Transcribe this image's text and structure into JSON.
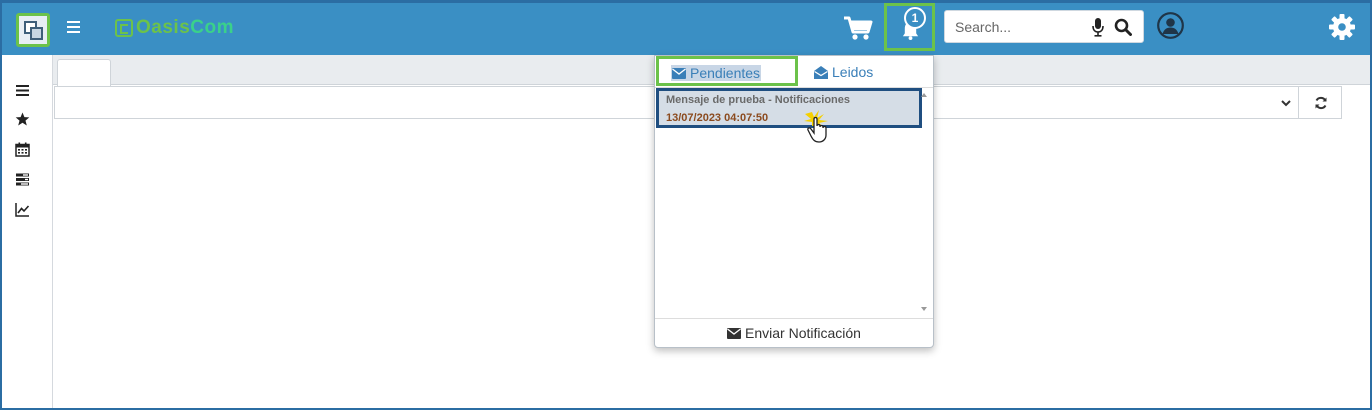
{
  "header": {
    "logo_text_1": "Oasis",
    "logo_text_2": "Com",
    "notification_count": "1",
    "search_placeholder": "Search...",
    "accent_color": "#3a8fc4",
    "highlight_color": "#6cc24a"
  },
  "sidebar": {
    "items": [
      {
        "icon": "list-icon"
      },
      {
        "icon": "star-icon"
      },
      {
        "icon": "calendar-icon"
      },
      {
        "icon": "tasks-icon"
      },
      {
        "icon": "line-chart-icon"
      }
    ]
  },
  "notifications": {
    "tabs": [
      {
        "label": "Pendientes",
        "icon": "envelope-icon",
        "active": true
      },
      {
        "label": "Leidos",
        "icon": "envelope-open-icon",
        "active": false
      }
    ],
    "items": [
      {
        "title": "Mensaje de prueba - Notificaciones",
        "date": "13/07/2023 04:07:50"
      }
    ],
    "footer_label": "Enviar Notificación"
  }
}
